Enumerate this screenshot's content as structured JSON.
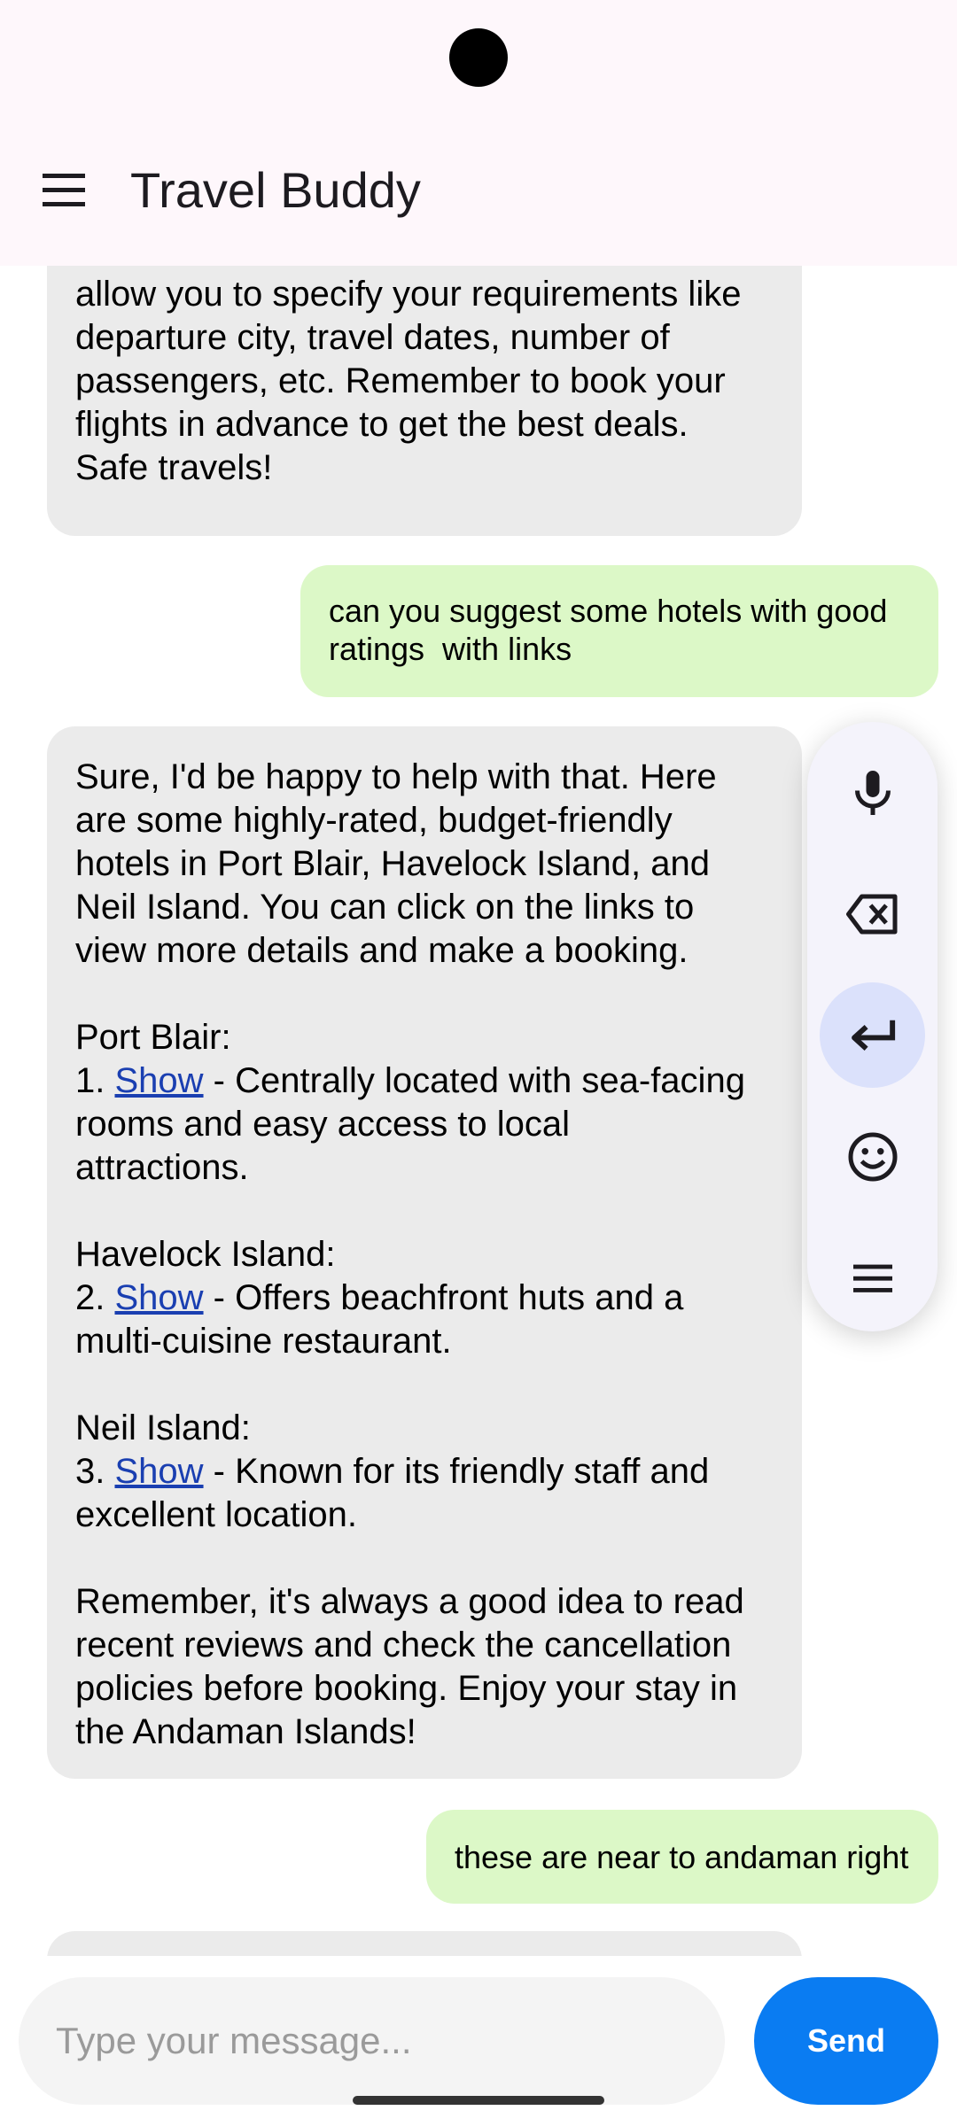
{
  "app": {
    "title": "Travel Buddy"
  },
  "messages": {
    "bot1": {
      "lines": [
        "allow you to specify your requirements like",
        "departure city, travel dates, number of",
        "passengers, etc. Remember to book your",
        "flights in advance to get the best deals.",
        "Safe travels!"
      ]
    },
    "user1": {
      "lines": [
        "can you suggest some hotels with good",
        "ratings  with links"
      ]
    },
    "bot2": {
      "intro": [
        "Sure, I'd be happy to help with that. Here",
        "are some highly-rated, budget-friendly",
        "hotels in Port Blair, Havelock Island, and",
        "Neil Island. You can click on the links to",
        "view more details and make a booking."
      ],
      "sections": [
        {
          "heading": "Port Blair:",
          "num": "1. ",
          "link": "Show",
          "rest_first": " - Centrally located with sea-facing",
          "rest_lines": [
            "rooms and easy access to local",
            "attractions."
          ]
        },
        {
          "heading": "Havelock Island:",
          "num": "2. ",
          "link": "Show",
          "rest_first": " - Offers beachfront huts and a",
          "rest_lines": [
            "multi-cuisine restaurant."
          ]
        },
        {
          "heading": "Neil Island:",
          "num": "3. ",
          "link": "Show",
          "rest_first": " - Known for its friendly staff and",
          "rest_lines": [
            "excellent location."
          ]
        }
      ],
      "outro": [
        "Remember, it's always a good idea to read",
        "recent reviews and check the cancellation",
        "policies before booking. Enjoy your stay in",
        "the Andaman Islands!"
      ]
    },
    "user2": {
      "text": "these are near to andaman right"
    }
  },
  "toolbar": {
    "buttons": [
      "mic-icon",
      "backspace-icon",
      "enter-icon",
      "emoji-icon",
      "menu-icon"
    ],
    "active": "enter-icon"
  },
  "input": {
    "placeholder": "Type your message...",
    "value": ""
  },
  "send": {
    "label": "Send"
  },
  "colors": {
    "bot_bubble": "#ebebeb",
    "user_bubble": "#dcf8c7",
    "send_button": "#0a7cf2",
    "link": "#1a3fb1",
    "header_bg": "#fef7fb"
  }
}
